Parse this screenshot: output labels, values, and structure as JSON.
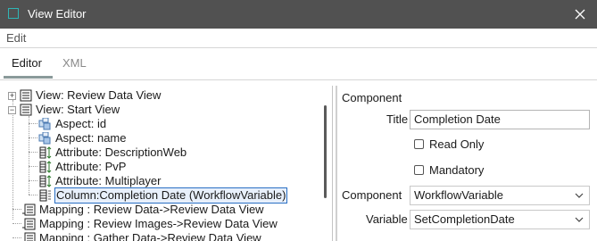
{
  "window": {
    "title": "View Editor",
    "close_glyph": "✕"
  },
  "menu": {
    "edit": "Edit"
  },
  "tabs": [
    {
      "label": "Editor",
      "active": true
    },
    {
      "label": "XML",
      "active": false
    }
  ],
  "tree": {
    "items": [
      {
        "label": "View: Review Data View",
        "icon": "view-icon",
        "expander": "+"
      },
      {
        "label": "View: Start View",
        "icon": "view-icon",
        "expander": "−"
      },
      {
        "label": "Aspect: id",
        "icon": "aspect-icon"
      },
      {
        "label": "Aspect: name",
        "icon": "aspect-icon"
      },
      {
        "label": "Attribute: DescriptionWeb",
        "icon": "attribute-icon"
      },
      {
        "label": "Attribute: PvP",
        "icon": "attribute-icon"
      },
      {
        "label": "Attribute: Multiplayer",
        "icon": "attribute-icon"
      },
      {
        "label": "Column:Completion Date (WorkflowVariable)",
        "icon": "column-icon",
        "selected": true
      },
      {
        "label": "Mapping : Review Data->Review Data View",
        "icon": "mapping-icon"
      },
      {
        "label": "Mapping : Review Images->Review Data View",
        "icon": "mapping-icon"
      },
      {
        "label": "Mapping : Gather Data->Review Data View",
        "icon": "mapping-icon"
      }
    ]
  },
  "component": {
    "section_title": "Component",
    "title_label": "Title",
    "title_value": "Completion Date",
    "read_only_label": "Read Only",
    "read_only": false,
    "mandatory_label": "Mandatory",
    "mandatory": false,
    "component_label": "Component",
    "component_value": "WorkflowVariable",
    "variable_label": "Variable",
    "variable_value": "SetCompletionDate"
  }
}
